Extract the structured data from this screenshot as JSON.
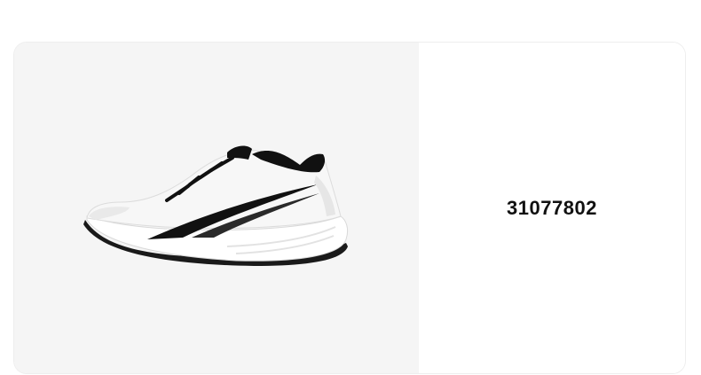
{
  "product": {
    "code": "31077802",
    "image_icon": "running-shoe-image",
    "colors": {
      "image_background": "#f5f5f5",
      "shoe_upper": "#f7f7f7",
      "shoe_accent": "#111111",
      "sole": "#ffffff"
    }
  }
}
